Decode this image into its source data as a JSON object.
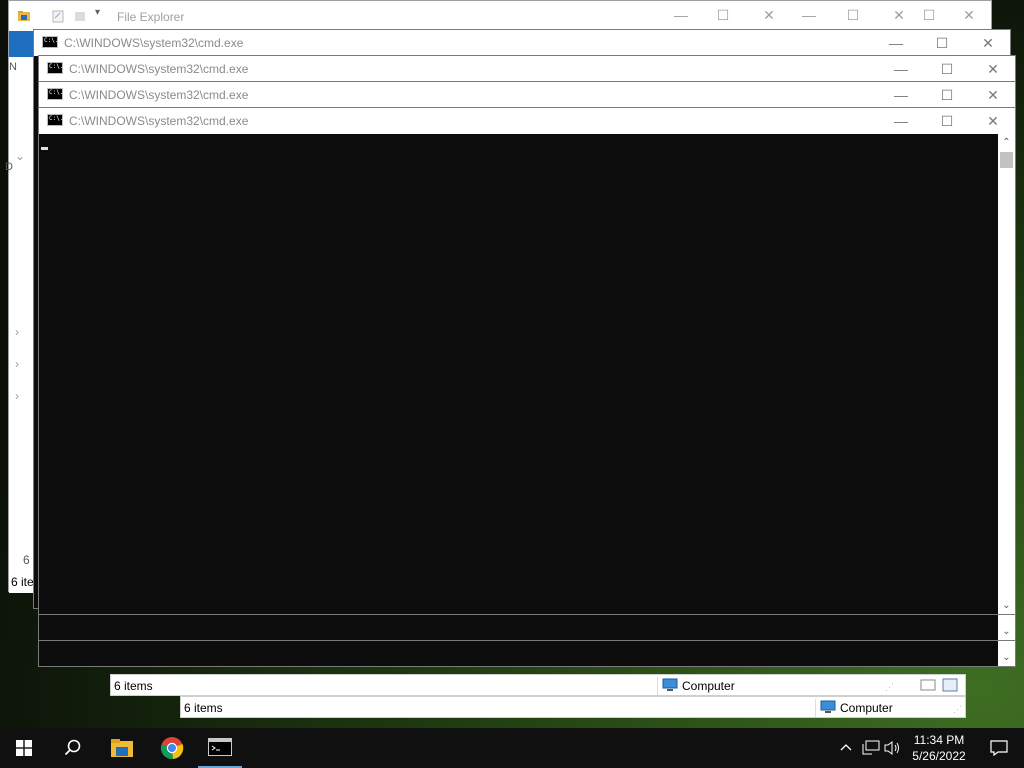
{
  "explorer_back": {
    "title": "File Explorer",
    "status_fragment": "6 ite",
    "count_fragment": "6",
    "side_letters": [
      "N",
      "D"
    ]
  },
  "explorer_mid": {
    "status_items": "6 items",
    "location": "Computer"
  },
  "explorer_front": {
    "status_items": "6 items",
    "location": "Computer"
  },
  "cmd_windows": [
    {
      "title": "C:\\WINDOWS\\system32\\cmd.exe"
    },
    {
      "title": "C:\\WINDOWS\\system32\\cmd.exe"
    },
    {
      "title": "C:\\WINDOWS\\system32\\cmd.exe"
    },
    {
      "title": "C:\\WINDOWS\\system32\\cmd.exe"
    }
  ],
  "window_controls": {
    "minimize": "—",
    "maximize": "☐",
    "close": "✕"
  },
  "taskbar": {
    "apps": [
      {
        "name": "start",
        "icon": "windows-logo-icon"
      },
      {
        "name": "search",
        "icon": "search-icon"
      },
      {
        "name": "file-explorer",
        "icon": "folder-icon"
      },
      {
        "name": "chrome",
        "icon": "chrome-icon"
      },
      {
        "name": "command-prompt",
        "icon": "cmd-icon",
        "active": true
      }
    ],
    "tray": {
      "time": "11:34 PM",
      "date": "5/26/2022"
    }
  },
  "colors": {
    "console_bg": "#0c0c0c",
    "ribbon_blue": "#1e6fc0",
    "taskbar_bg": "#101010"
  }
}
